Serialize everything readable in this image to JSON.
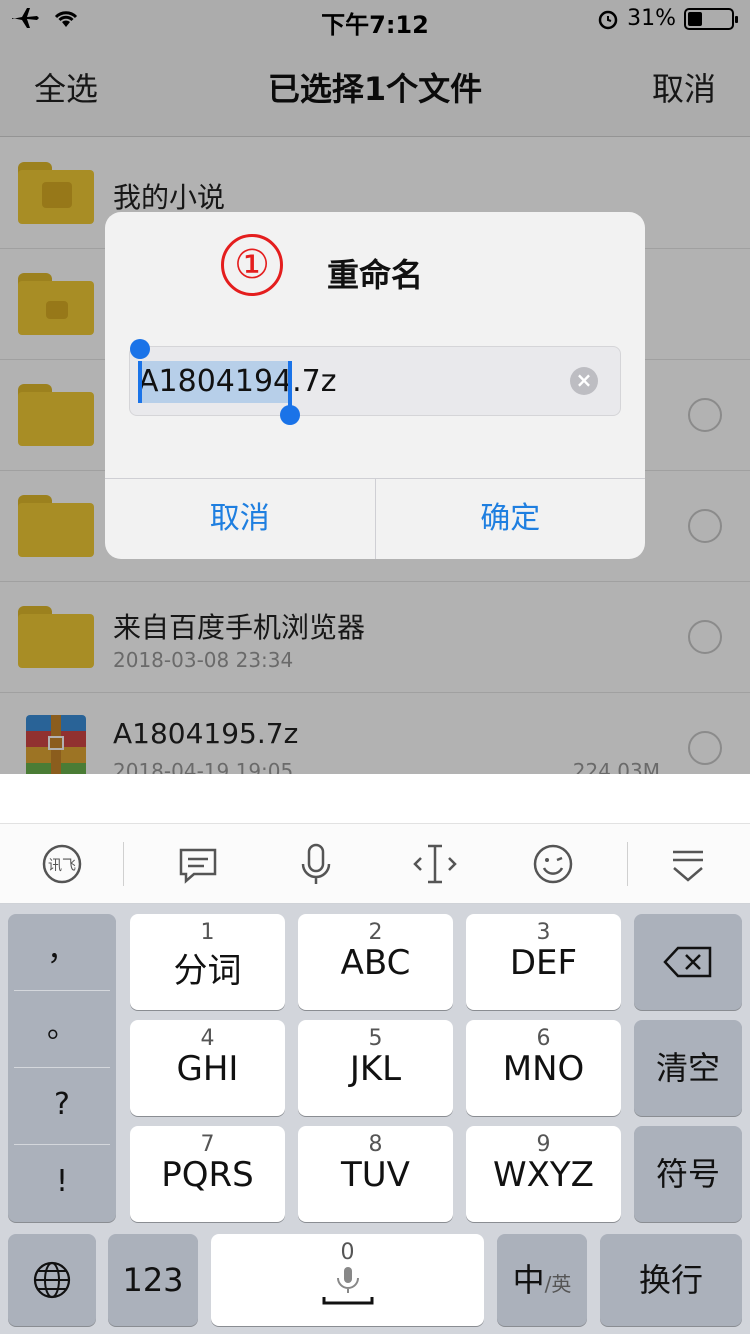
{
  "status_bar": {
    "time": "下午7:12",
    "battery": "31%"
  },
  "nav": {
    "left": "全选",
    "title": "已选择1个文件",
    "right": "取消"
  },
  "files": [
    {
      "name": "我的小说",
      "meta": "",
      "size": "",
      "icon": "folder-book-icon"
    },
    {
      "name": "",
      "meta": "",
      "size": "",
      "icon": "folder-lock-icon"
    },
    {
      "name": "",
      "meta": "",
      "size": "",
      "icon": "folder-icon"
    },
    {
      "name": "",
      "meta": "",
      "size": "",
      "icon": "folder-icon"
    },
    {
      "name": "来自百度手机浏览器",
      "meta": "2018-03-08 23:34",
      "size": "",
      "icon": "folder-icon"
    },
    {
      "name": "A1804195.7z",
      "meta": "2018-04-19 19:05",
      "size": "224.03M",
      "icon": "archive-icon"
    }
  ],
  "dialog": {
    "annotation": "①",
    "title": "重命名",
    "input_value": "A1804194.7z",
    "cancel": "取消",
    "confirm": "确定"
  },
  "keyboard": {
    "punctuation": [
      "，",
      "。",
      "?",
      "!"
    ],
    "keys": [
      {
        "num": "1",
        "label": "分词"
      },
      {
        "num": "2",
        "label": "ABC"
      },
      {
        "num": "3",
        "label": "DEF"
      },
      {
        "num": "4",
        "label": "GHI"
      },
      {
        "num": "5",
        "label": "JKL"
      },
      {
        "num": "6",
        "label": "MNO"
      },
      {
        "num": "7",
        "label": "PQRS"
      },
      {
        "num": "8",
        "label": "TUV"
      },
      {
        "num": "9",
        "label": "WXYZ"
      }
    ],
    "clear": "清空",
    "symbols": "符号",
    "numbers": "123",
    "space_num": "0",
    "lang_main": "中",
    "lang_sub": "/英",
    "enter": "换行"
  }
}
